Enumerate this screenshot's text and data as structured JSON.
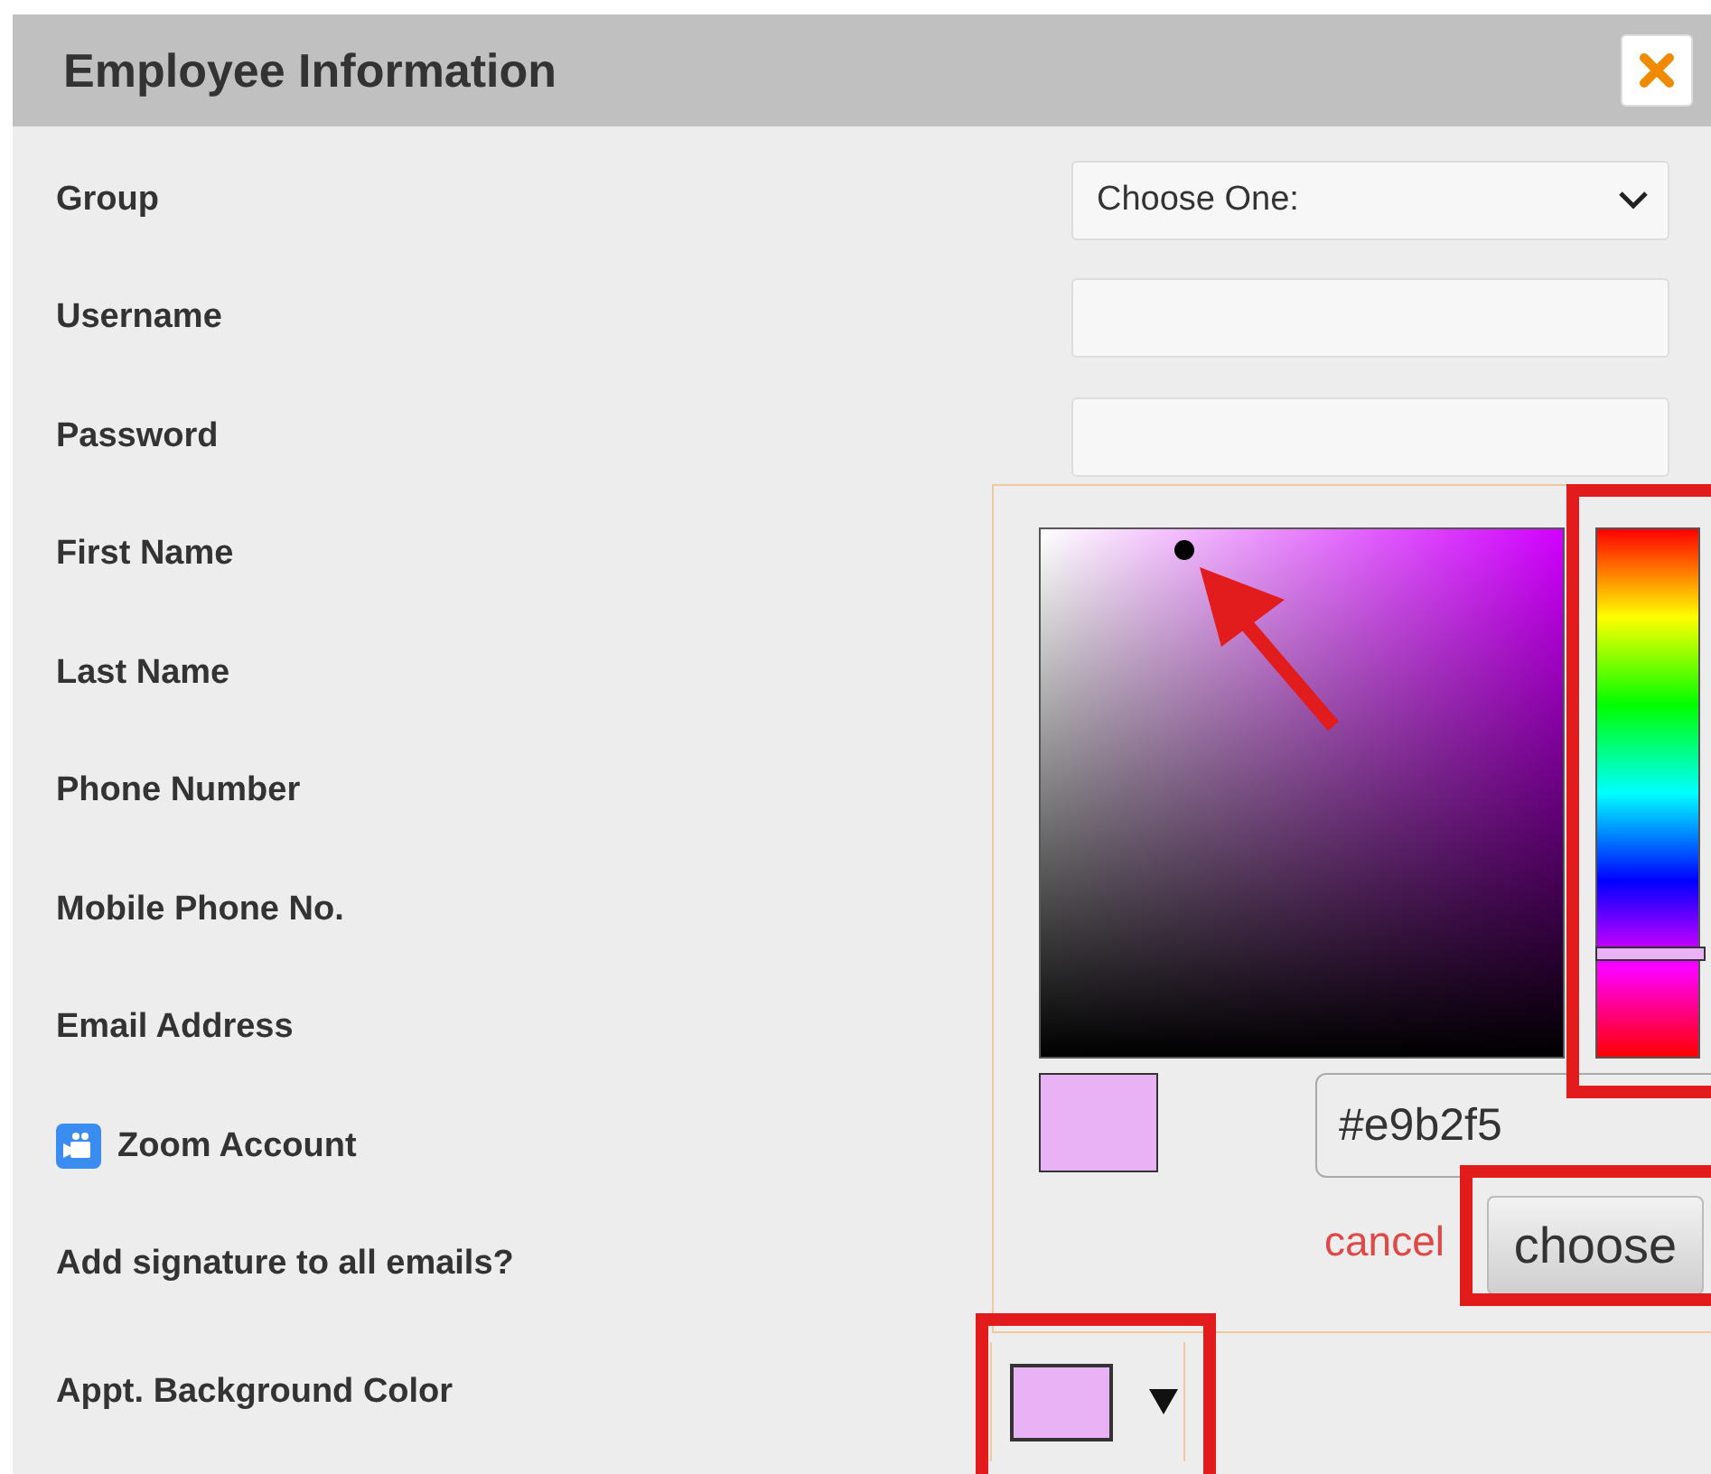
{
  "dialog": {
    "title": "Employee Information"
  },
  "fields": [
    {
      "label": "Group",
      "kind": "select",
      "value": "Choose One:"
    },
    {
      "label": "Username",
      "kind": "text"
    },
    {
      "label": "Password",
      "kind": "text"
    },
    {
      "label": "First Name",
      "kind": "covered"
    },
    {
      "label": "Last Name",
      "kind": "covered"
    },
    {
      "label": "Phone Number",
      "kind": "covered"
    },
    {
      "label": "Mobile Phone No.",
      "kind": "covered"
    },
    {
      "label": "Email Address",
      "kind": "covered"
    },
    {
      "label": "Zoom Account",
      "kind": "zoom"
    },
    {
      "label": "Add signature to all emails?",
      "kind": "covered"
    },
    {
      "label": "Appt. Background Color",
      "kind": "color",
      "color": "#e9b2f5"
    }
  ],
  "color_picker": {
    "hex": "#e9b2f5",
    "cancel": "cancel",
    "choose": "choose"
  }
}
